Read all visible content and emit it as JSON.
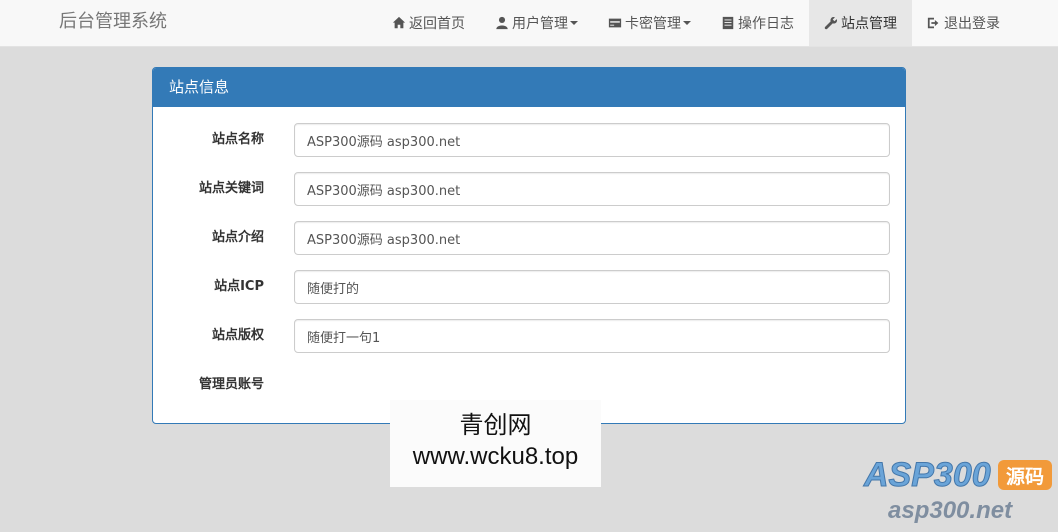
{
  "nav": {
    "brand": "后台管理系统",
    "items": [
      {
        "label": "返回首页",
        "icon": "home-icon"
      },
      {
        "label": "用户管理",
        "icon": "user-icon",
        "dropdown": true
      },
      {
        "label": "卡密管理",
        "icon": "card-icon",
        "dropdown": true
      },
      {
        "label": "操作日志",
        "icon": "log-icon"
      },
      {
        "label": "站点管理",
        "icon": "wrench-icon",
        "active": true
      },
      {
        "label": "退出登录",
        "icon": "logout-icon"
      }
    ]
  },
  "panel": {
    "title": "站点信息",
    "fields": [
      {
        "label": "站点名称",
        "value": "ASP300源码 asp300.net"
      },
      {
        "label": "站点关键词",
        "value": "ASP300源码 asp300.net"
      },
      {
        "label": "站点介绍",
        "value": "ASP300源码 asp300.net"
      },
      {
        "label": "站点ICP",
        "value": "随便打的"
      },
      {
        "label": "站点版权",
        "value": "随便打一句1"
      },
      {
        "label": "管理员账号",
        "value": ""
      }
    ]
  },
  "watermark": {
    "line1": "青创网",
    "line2": "www.wcku8.top",
    "logo_text": "ASP300",
    "logo_badge": "源码",
    "logo_url": "asp300.net"
  },
  "colors": {
    "primary": "#337ab7",
    "background": "#dcdcdc",
    "navbar": "#f8f8f8"
  }
}
